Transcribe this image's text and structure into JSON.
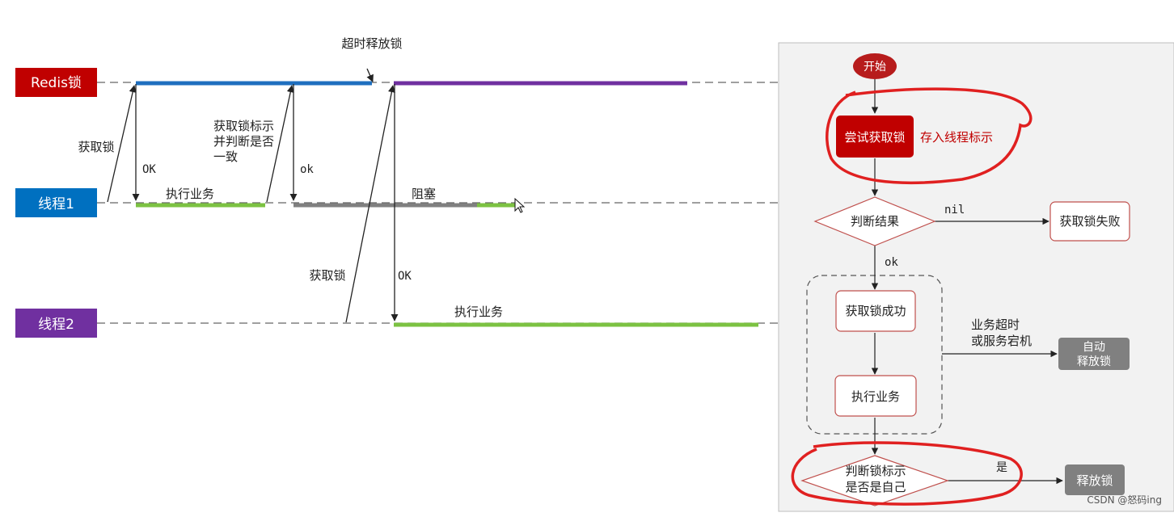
{
  "timeline": {
    "lanes": {
      "redis": "Redis锁",
      "thread1": "线程1",
      "thread2": "线程2"
    },
    "labels": {
      "timeout_release": "超时释放锁",
      "acquire_lock_1": "获取锁",
      "ok_1": "OK",
      "check_id_line1": "获取锁标示",
      "check_id_line2": "并判断是否",
      "check_id_line3": "一致",
      "ok_2": "ok",
      "exec_business_1": "执行业务",
      "blocked": "阻塞",
      "acquire_lock_2": "获取锁",
      "ok_3": "OK",
      "exec_business_2": "执行业务"
    }
  },
  "flowchart": {
    "start": "开始",
    "try_lock": "尝试获取锁",
    "store_thread_id": "存入线程标示",
    "judge_result": "判断结果",
    "nil_label": "nil",
    "lock_failed": "获取锁失败",
    "ok_label": "ok",
    "lock_success": "获取锁成功",
    "timeout_line1": "业务超时",
    "timeout_line2": "或服务宕机",
    "auto_release_line1": "自动",
    "auto_release_line2": "释放锁",
    "exec_business": "执行业务",
    "check_owner_line1": "判断锁标示",
    "check_owner_line2": "是否是自己",
    "yes_label": "是",
    "release_lock": "释放锁"
  },
  "watermark": "CSDN @怒码ing",
  "colors": {
    "redis_lane": "#c00000",
    "thread1_lane": "#0070c0",
    "thread2_lane": "#7030a0",
    "redis_hold_thread1": "#1f6fbf",
    "redis_hold_thread2": "#7030a0",
    "business_bar": "#7cc242",
    "blocked_bar": "#808080",
    "flow_primary": "#c00000",
    "flow_gray": "#808080",
    "annotation_red": "#e02020"
  }
}
